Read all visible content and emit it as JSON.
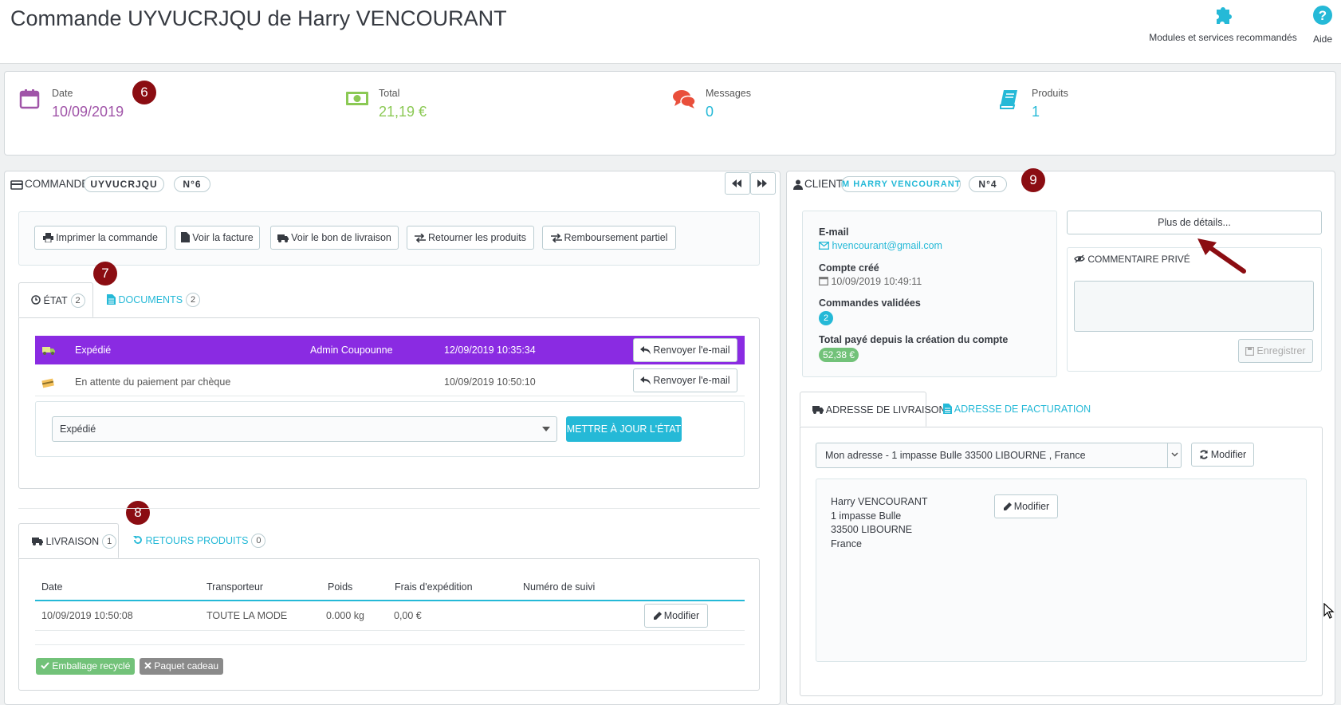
{
  "header": {
    "title": "Commande UYVUCRJQU de Harry VENCOURANT",
    "modules_label": "Modules et services recommandés",
    "help_label": "Aide"
  },
  "kpis": [
    {
      "label": "Date",
      "value": "10/09/2019",
      "color": "#a054a8",
      "icon": "calendar-icon"
    },
    {
      "label": "Total",
      "value": "21,19 €",
      "color": "#8bc954",
      "icon": "money-icon"
    },
    {
      "label": "Messages",
      "value": "0",
      "color": "#25b9d7",
      "icon": "comments-icon"
    },
    {
      "label": "Produits",
      "value": "1",
      "color": "#25b9d7",
      "icon": "book-icon"
    }
  ],
  "callouts": [
    "6",
    "7",
    "8",
    "9"
  ],
  "order": {
    "heading": "COMMANDE",
    "reference": "UYVUCRJQU",
    "number": "N°6",
    "actions": [
      "Imprimer la commande",
      "Voir la facture",
      "Voir le bon de livraison",
      "Retourner les produits",
      "Remboursement partiel"
    ],
    "tabs": {
      "state_label": "ÉTAT",
      "state_count": "2",
      "documents_label": "DOCUMENTS",
      "documents_count": "2"
    },
    "history": [
      {
        "status": "Expédié",
        "employee": "Admin Coupounne",
        "date": "12/09/2019 10:35:34",
        "action": "Renvoyer l'e-mail",
        "highlight": "#8a2be2"
      },
      {
        "status": "En attente du paiement par chèque",
        "employee": "",
        "date": "10/09/2019 10:50:10",
        "action": "Renvoyer l'e-mail"
      }
    ],
    "state_select": "Expédié",
    "update_button": "METTRE À JOUR L'ÉTAT",
    "shipping_tabs": {
      "shipping_label": "LIVRAISON",
      "shipping_count": "1",
      "returns_label": "RETOURS PRODUITS",
      "returns_count": "0"
    },
    "shipping_headers": [
      "Date",
      "Transporteur",
      "Poids",
      "Frais d'expédition",
      "Numéro de suivi"
    ],
    "shipping_row": {
      "date": "10/09/2019 10:50:08",
      "carrier": "TOUTE LA MODE",
      "weight": "0.000 kg",
      "cost": "0,00 €",
      "tracking": "",
      "action": "Modifier"
    },
    "tags": [
      {
        "label": "Emballage recyclé",
        "color": "#72c279"
      },
      {
        "label": "Paquet cadeau",
        "color": "#8a8a8a"
      }
    ]
  },
  "client": {
    "heading": "CLIENT",
    "name_pill": "M HARRY VENCOURANT",
    "number": "N°4",
    "email_label": "E-mail",
    "email": "hvencourant@gmail.com",
    "created_label": "Compte créé",
    "created": "10/09/2019 10:49:11",
    "orders_label": "Commandes validées",
    "orders_count": "2",
    "total_label": "Total payé depuis la création du compte",
    "total": "52,38 €",
    "more_details": "Plus de détails...",
    "private_comment_label": "COMMENTAIRE PRIVÉ",
    "save_label": "Enregistrer",
    "address_tabs": {
      "shipping": "ADRESSE DE LIVRAISON",
      "invoice": "ADRESSE DE FACTURATION"
    },
    "address_select": "Mon adresse - 1 impasse Bulle 33500 LIBOURNE , France",
    "modify_label": "Modifier",
    "address_lines": [
      "Harry VENCOURANT",
      "1 impasse Bulle",
      "33500 LIBOURNE",
      "France"
    ],
    "address_modify": "Modifier"
  },
  "colors": {
    "accent": "#25b9d7",
    "callout": "#8b0d12",
    "highlight_row": "#8a2be2"
  }
}
